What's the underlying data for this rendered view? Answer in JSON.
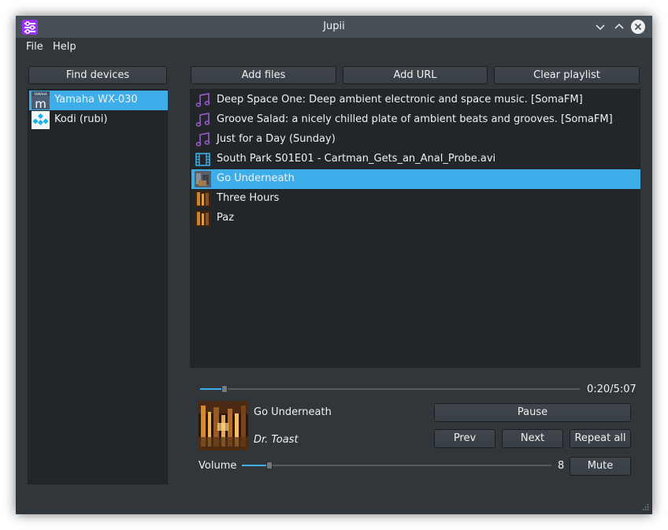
{
  "window": {
    "title": "Jupii"
  },
  "menu": [
    "File",
    "Help"
  ],
  "devices_panel": {
    "find_button": "Find devices",
    "items": [
      {
        "label": "Yamaha WX-030",
        "icon": "yamaha-musiccast-icon",
        "selected": true
      },
      {
        "label": "Kodi (rubi)",
        "icon": "kodi-icon",
        "selected": false
      }
    ]
  },
  "toolbar": {
    "add_files": "Add files",
    "add_url": "Add URL",
    "clear_playlist": "Clear playlist"
  },
  "playlist": [
    {
      "label": "Deep Space One: Deep ambient electronic and space music. [SomaFM]",
      "icon": "music-note-icon"
    },
    {
      "label": "Groove Salad: a nicely chilled plate of ambient beats and grooves. [SomaFM]",
      "icon": "music-note-icon"
    },
    {
      "label": "Just for a Day (Sunday)",
      "icon": "music-note-icon"
    },
    {
      "label": "South Park S01E01 - Cartman_Gets_an_Anal_Probe.avi",
      "icon": "film-icon"
    },
    {
      "label": "Go Underneath",
      "icon": "album-art-thumbnail",
      "selected": true
    },
    {
      "label": "Three Hours",
      "icon": "album-art-thumbnail"
    },
    {
      "label": "Paz",
      "icon": "album-art-thumbnail"
    }
  ],
  "player": {
    "time": "0:20/5:07",
    "progress_fraction": 0.065,
    "track_title": "Go Underneath",
    "artist": "Dr. Toast",
    "pause": "Pause",
    "prev": "Prev",
    "next": "Next",
    "repeat": "Repeat all",
    "volume_label": "Volume",
    "volume_value": "8",
    "volume_fraction": 0.09,
    "mute": "Mute"
  },
  "colors": {
    "accent": "#3daee9",
    "window_bg": "#31363b",
    "list_bg": "#232629",
    "titlebar": "#475057",
    "app_icon": "#9b30ff"
  }
}
